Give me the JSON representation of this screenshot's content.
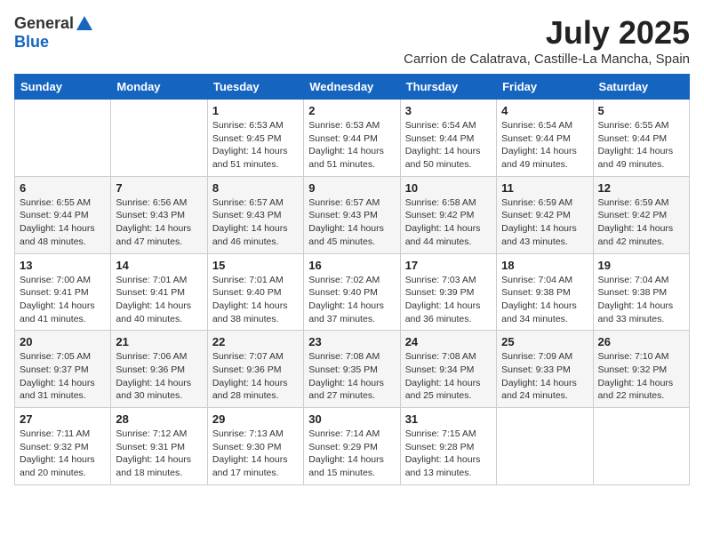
{
  "logo": {
    "general": "General",
    "blue": "Blue"
  },
  "header": {
    "month_year": "July 2025",
    "location": "Carrion de Calatrava, Castille-La Mancha, Spain"
  },
  "weekdays": [
    "Sunday",
    "Monday",
    "Tuesday",
    "Wednesday",
    "Thursday",
    "Friday",
    "Saturday"
  ],
  "weeks": [
    [
      {
        "day": "",
        "info": ""
      },
      {
        "day": "",
        "info": ""
      },
      {
        "day": "1",
        "info": "Sunrise: 6:53 AM\nSunset: 9:45 PM\nDaylight: 14 hours and 51 minutes."
      },
      {
        "day": "2",
        "info": "Sunrise: 6:53 AM\nSunset: 9:44 PM\nDaylight: 14 hours and 51 minutes."
      },
      {
        "day": "3",
        "info": "Sunrise: 6:54 AM\nSunset: 9:44 PM\nDaylight: 14 hours and 50 minutes."
      },
      {
        "day": "4",
        "info": "Sunrise: 6:54 AM\nSunset: 9:44 PM\nDaylight: 14 hours and 49 minutes."
      },
      {
        "day": "5",
        "info": "Sunrise: 6:55 AM\nSunset: 9:44 PM\nDaylight: 14 hours and 49 minutes."
      }
    ],
    [
      {
        "day": "6",
        "info": "Sunrise: 6:55 AM\nSunset: 9:44 PM\nDaylight: 14 hours and 48 minutes."
      },
      {
        "day": "7",
        "info": "Sunrise: 6:56 AM\nSunset: 9:43 PM\nDaylight: 14 hours and 47 minutes."
      },
      {
        "day": "8",
        "info": "Sunrise: 6:57 AM\nSunset: 9:43 PM\nDaylight: 14 hours and 46 minutes."
      },
      {
        "day": "9",
        "info": "Sunrise: 6:57 AM\nSunset: 9:43 PM\nDaylight: 14 hours and 45 minutes."
      },
      {
        "day": "10",
        "info": "Sunrise: 6:58 AM\nSunset: 9:42 PM\nDaylight: 14 hours and 44 minutes."
      },
      {
        "day": "11",
        "info": "Sunrise: 6:59 AM\nSunset: 9:42 PM\nDaylight: 14 hours and 43 minutes."
      },
      {
        "day": "12",
        "info": "Sunrise: 6:59 AM\nSunset: 9:42 PM\nDaylight: 14 hours and 42 minutes."
      }
    ],
    [
      {
        "day": "13",
        "info": "Sunrise: 7:00 AM\nSunset: 9:41 PM\nDaylight: 14 hours and 41 minutes."
      },
      {
        "day": "14",
        "info": "Sunrise: 7:01 AM\nSunset: 9:41 PM\nDaylight: 14 hours and 40 minutes."
      },
      {
        "day": "15",
        "info": "Sunrise: 7:01 AM\nSunset: 9:40 PM\nDaylight: 14 hours and 38 minutes."
      },
      {
        "day": "16",
        "info": "Sunrise: 7:02 AM\nSunset: 9:40 PM\nDaylight: 14 hours and 37 minutes."
      },
      {
        "day": "17",
        "info": "Sunrise: 7:03 AM\nSunset: 9:39 PM\nDaylight: 14 hours and 36 minutes."
      },
      {
        "day": "18",
        "info": "Sunrise: 7:04 AM\nSunset: 9:38 PM\nDaylight: 14 hours and 34 minutes."
      },
      {
        "day": "19",
        "info": "Sunrise: 7:04 AM\nSunset: 9:38 PM\nDaylight: 14 hours and 33 minutes."
      }
    ],
    [
      {
        "day": "20",
        "info": "Sunrise: 7:05 AM\nSunset: 9:37 PM\nDaylight: 14 hours and 31 minutes."
      },
      {
        "day": "21",
        "info": "Sunrise: 7:06 AM\nSunset: 9:36 PM\nDaylight: 14 hours and 30 minutes."
      },
      {
        "day": "22",
        "info": "Sunrise: 7:07 AM\nSunset: 9:36 PM\nDaylight: 14 hours and 28 minutes."
      },
      {
        "day": "23",
        "info": "Sunrise: 7:08 AM\nSunset: 9:35 PM\nDaylight: 14 hours and 27 minutes."
      },
      {
        "day": "24",
        "info": "Sunrise: 7:08 AM\nSunset: 9:34 PM\nDaylight: 14 hours and 25 minutes."
      },
      {
        "day": "25",
        "info": "Sunrise: 7:09 AM\nSunset: 9:33 PM\nDaylight: 14 hours and 24 minutes."
      },
      {
        "day": "26",
        "info": "Sunrise: 7:10 AM\nSunset: 9:32 PM\nDaylight: 14 hours and 22 minutes."
      }
    ],
    [
      {
        "day": "27",
        "info": "Sunrise: 7:11 AM\nSunset: 9:32 PM\nDaylight: 14 hours and 20 minutes."
      },
      {
        "day": "28",
        "info": "Sunrise: 7:12 AM\nSunset: 9:31 PM\nDaylight: 14 hours and 18 minutes."
      },
      {
        "day": "29",
        "info": "Sunrise: 7:13 AM\nSunset: 9:30 PM\nDaylight: 14 hours and 17 minutes."
      },
      {
        "day": "30",
        "info": "Sunrise: 7:14 AM\nSunset: 9:29 PM\nDaylight: 14 hours and 15 minutes."
      },
      {
        "day": "31",
        "info": "Sunrise: 7:15 AM\nSunset: 9:28 PM\nDaylight: 14 hours and 13 minutes."
      },
      {
        "day": "",
        "info": ""
      },
      {
        "day": "",
        "info": ""
      }
    ]
  ]
}
